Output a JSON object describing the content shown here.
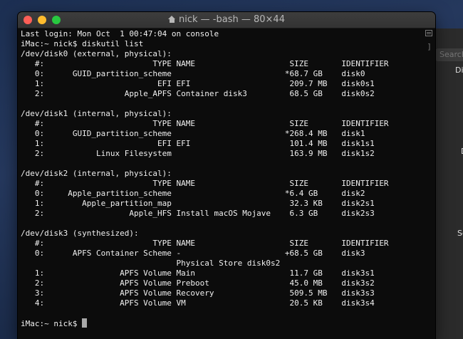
{
  "window": {
    "title": "nick — -bash — 80×44",
    "title_icon": "home-icon"
  },
  "background": {
    "search_placeholder": "Search",
    "fragments": [
      "Di",
      "D",
      "Sc"
    ]
  },
  "terminal": {
    "lines": [
      "Last login: Mon Oct  1 00:47:04 on console",
      "iMac:~ nick$ diskutil list",
      "/dev/disk0 (external, physical):",
      "   #:                       TYPE NAME                    SIZE       IDENTIFIER",
      "   0:      GUID_partition_scheme                        *68.7 GB    disk0",
      "   1:                        EFI EFI                     209.7 MB   disk0s1",
      "   2:                 Apple_APFS Container disk3         68.5 GB    disk0s2",
      "",
      "/dev/disk1 (internal, physical):",
      "   #:                       TYPE NAME                    SIZE       IDENTIFIER",
      "   0:      GUID_partition_scheme                        *268.4 MB   disk1",
      "   1:                        EFI EFI                     101.4 MB   disk1s1",
      "   2:           Linux Filesystem                         163.9 MB   disk1s2",
      "",
      "/dev/disk2 (internal, physical):",
      "   #:                       TYPE NAME                    SIZE       IDENTIFIER",
      "   0:     Apple_partition_scheme                        *6.4 GB     disk2",
      "   1:        Apple_partition_map                         32.3 KB    disk2s1",
      "   2:                  Apple_HFS Install macOS Mojave    6.3 GB     disk2s3",
      "",
      "/dev/disk3 (synthesized):",
      "   #:                       TYPE NAME                    SIZE       IDENTIFIER",
      "   0:      APFS Container Scheme -                      +68.5 GB    disk3",
      "                                 Physical Store disk0s2",
      "   1:                APFS Volume Main                    11.7 GB    disk3s1",
      "   2:                APFS Volume Preboot                 45.0 MB    disk3s2",
      "   3:                APFS Volume Recovery                509.5 MB   disk3s3",
      "   4:                APFS Volume VM                      20.5 KB    disk3s4",
      "",
      "iMac:~ nick$ "
    ]
  }
}
